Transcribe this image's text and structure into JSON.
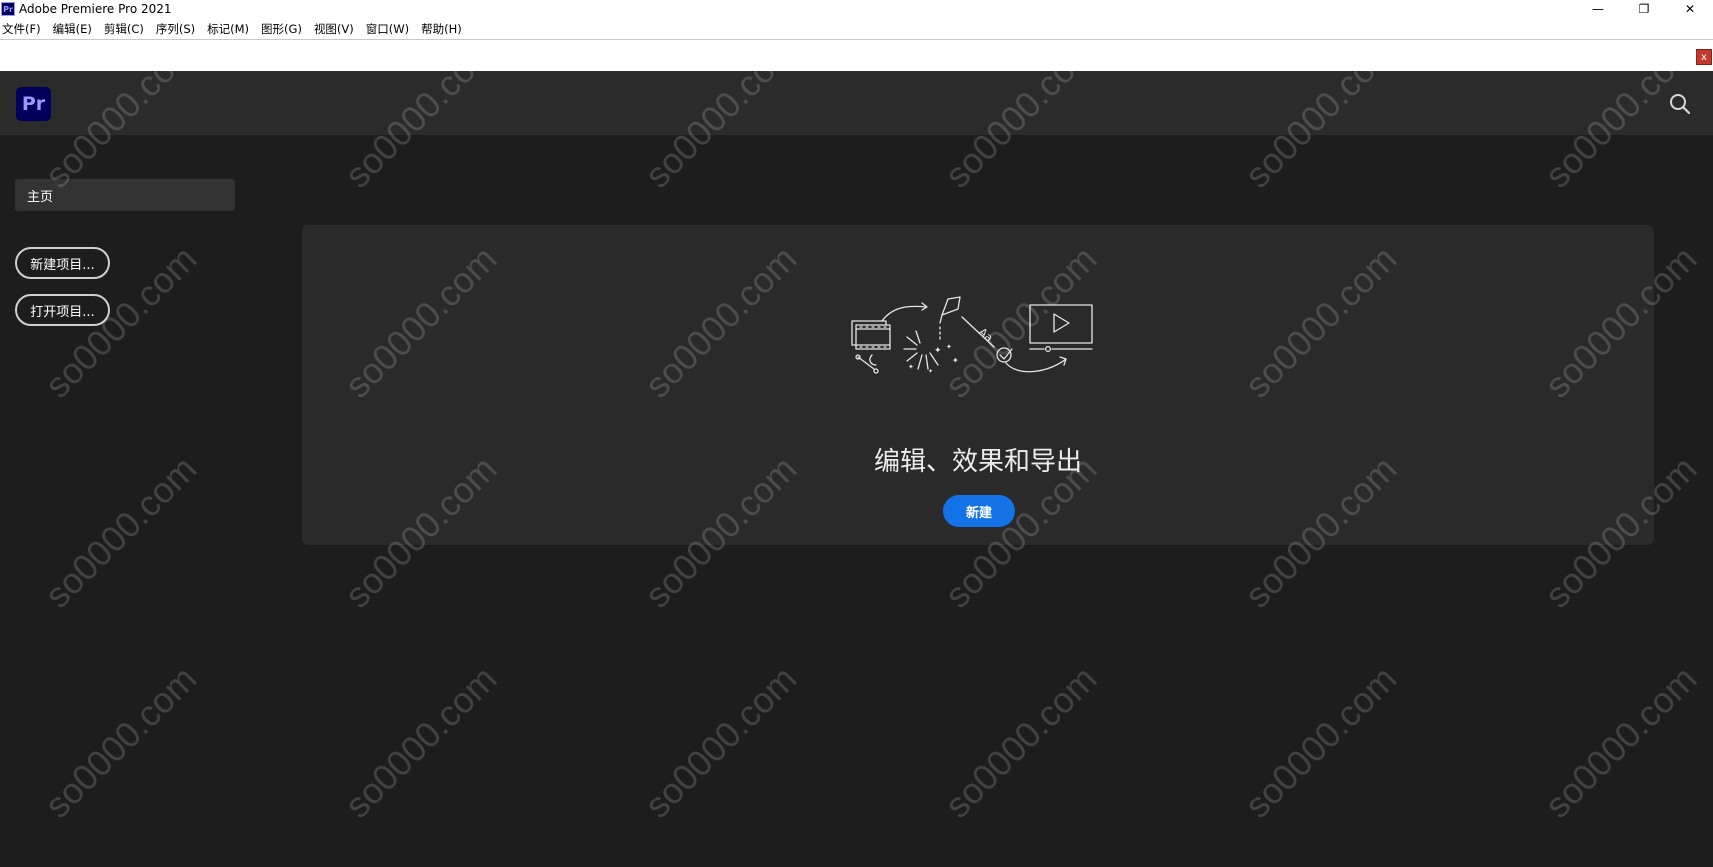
{
  "window": {
    "app_icon_text": "Pr",
    "title": "Adobe Premiere Pro 2021",
    "minimize": "—",
    "maximize": "❐",
    "close": "✕"
  },
  "menu": [
    {
      "label": "文件(F)"
    },
    {
      "label": "编辑(E)"
    },
    {
      "label": "剪辑(C)"
    },
    {
      "label": "序列(S)"
    },
    {
      "label": "标记(M)"
    },
    {
      "label": "图形(G)"
    },
    {
      "label": "视图(V)"
    },
    {
      "label": "窗口(W)"
    },
    {
      "label": "帮助(H)"
    }
  ],
  "strip": {
    "close_label": "x"
  },
  "header": {
    "logo_text": "Pr",
    "search_icon": "search-icon"
  },
  "sidebar": {
    "home_label": "主页",
    "new_project_label": "新建项目...",
    "open_project_label": "打开项目..."
  },
  "main": {
    "heading": "编辑、效果和导出",
    "new_button_label": "新建"
  },
  "watermark": {
    "text": "so0000.com"
  },
  "colors": {
    "background": "#1d1d1d",
    "header": "#2b2b2b",
    "card": "#2a2a2a",
    "accent": "#1473e6",
    "logo_bg": "#00005b",
    "logo_fg": "#9999ff"
  }
}
